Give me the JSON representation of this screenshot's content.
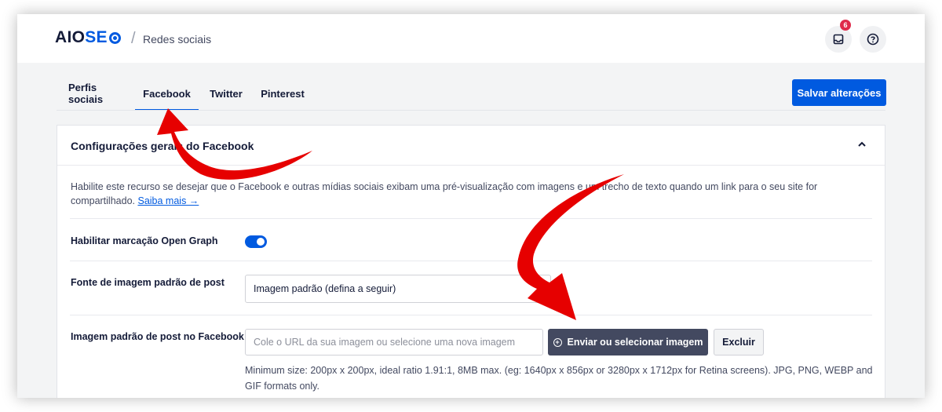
{
  "header": {
    "logo_main": "AIO",
    "logo_accent": "SE",
    "crumb_separator": "/",
    "breadcrumb": "Redes sociais",
    "notification_count": "6"
  },
  "tabs": [
    {
      "label": "Perfis sociais"
    },
    {
      "label": "Facebook",
      "active": true
    },
    {
      "label": "Twitter"
    },
    {
      "label": "Pinterest"
    }
  ],
  "save_label": "Salvar alterações",
  "card": {
    "title": "Configurações gerais do Facebook",
    "description": "Habilite este recurso se desejar que o Facebook e outras mídias sociais exibam uma pré-visualização com imagens e um trecho de texto quando um link para o seu site for compartilhado.",
    "link_text": "Saiba mais →",
    "open_graph_label": "Habilitar marcação Open Graph",
    "open_graph_enabled": true,
    "image_source_label": "Fonte de imagem padrão de post",
    "image_source_value": "Imagem padrão (defina a seguir)",
    "default_image_label": "Imagem padrão de post no Facebook",
    "image_url_placeholder": "Cole o URL da sua imagem ou selecione uma nova imagem",
    "upload_label": "Enviar ou selecionar imagem",
    "delete_label": "Excluir",
    "hint": "Minimum size: 200px x 200px, ideal ratio 1.91:1, 8MB max. (eg: 1640px x 856px or 3280px x 1712px for Retina screens). JPG, PNG, WEBP and GIF formats only."
  },
  "colors": {
    "accent": "#005ae0",
    "annotation_arrow": "#e60000",
    "badge": "#df2a4a"
  }
}
